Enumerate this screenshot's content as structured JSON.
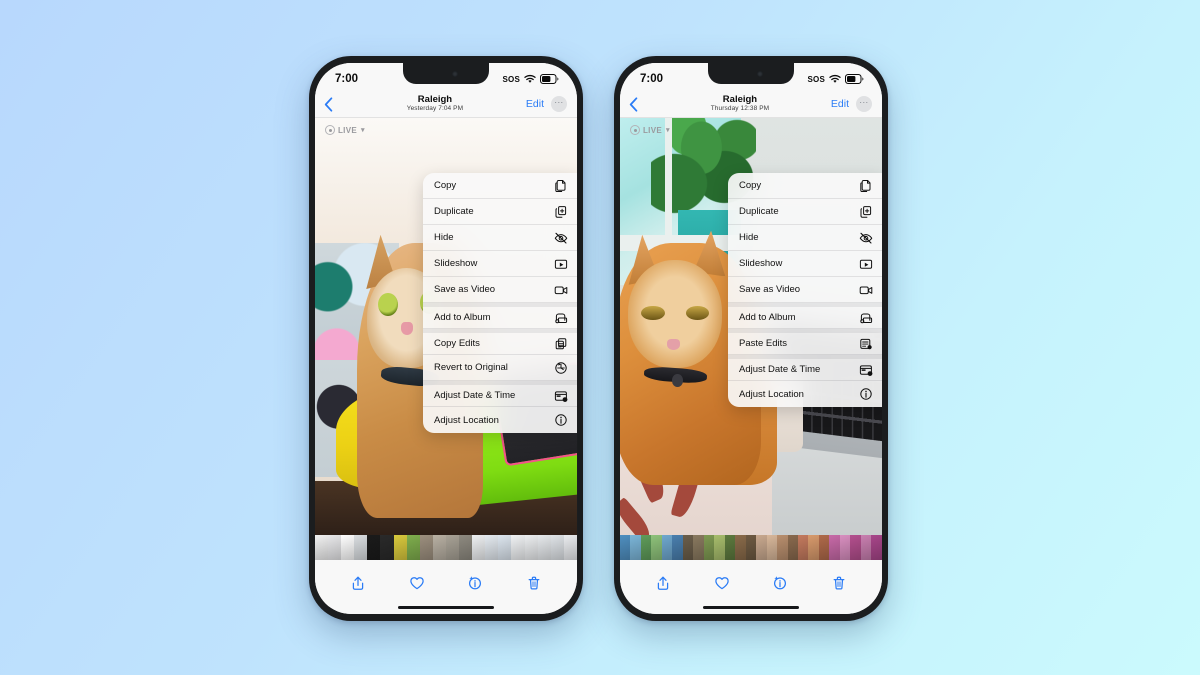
{
  "background": {
    "from": "#b8d8fd",
    "to": "#cbfafd"
  },
  "accent_color": "#2b7cf6",
  "phones": [
    {
      "id": "left",
      "status": {
        "time": "7:00",
        "sos": "SOS",
        "wifi_icon": "wifi-icon",
        "battery_icon": "battery-icon"
      },
      "nav": {
        "back_icon": "back-chevron-icon",
        "title": "Raleigh",
        "subtitle": "Yesterday  7:04 PM",
        "edit_label": "Edit",
        "more_label": "···"
      },
      "photo": {
        "live_label": "LIVE",
        "live_icon": "live-photo-icon",
        "chevron_icon": "chevron-down-icon",
        "alt": "ginger tabby cat standing on a yellow chair"
      },
      "menu": [
        {
          "label": "Copy",
          "icon": "copy-icon",
          "group_start": false
        },
        {
          "label": "Duplicate",
          "icon": "duplicate-icon",
          "group_start": false
        },
        {
          "label": "Hide",
          "icon": "eye-slash-icon",
          "group_start": false
        },
        {
          "label": "Slideshow",
          "icon": "slideshow-icon",
          "group_start": false
        },
        {
          "label": "Save as Video",
          "icon": "video-icon",
          "group_start": false
        },
        {
          "label": "Add to Album",
          "icon": "add-to-album-icon",
          "group_start": true
        },
        {
          "label": "Copy Edits",
          "icon": "copy-edits-icon",
          "group_start": true
        },
        {
          "label": "Revert to Original",
          "icon": "revert-icon",
          "group_start": false
        },
        {
          "label": "Adjust Date & Time",
          "icon": "calendar-clock-icon",
          "group_start": true
        },
        {
          "label": "Adjust Location",
          "icon": "location-info-icon",
          "group_start": false
        }
      ],
      "toolbar": [
        {
          "name": "share-button",
          "icon": "share-icon"
        },
        {
          "name": "favorite-button",
          "icon": "heart-icon"
        },
        {
          "name": "info-button",
          "icon": "info-sparkle-icon"
        },
        {
          "name": "delete-button",
          "icon": "trash-icon"
        }
      ],
      "filmstrip": [
        "#f2f2f2",
        "#e8e8ea",
        "#ffffff",
        "#d9dde0",
        "#1b1b1b",
        "#2a2a2a",
        "#d9c93d",
        "#7fae4d",
        "#9c8f7e",
        "#b8b0a3",
        "#a8a296",
        "#8e8a80",
        "#eef0f2",
        "#e4eaf0",
        "#dde6ef",
        "#f0f2f4",
        "#eceef0",
        "#e6e9ec",
        "#dfe3e7",
        "#eaecef"
      ]
    },
    {
      "id": "right",
      "status": {
        "time": "7:00",
        "sos": "SOS",
        "wifi_icon": "wifi-icon",
        "battery_icon": "battery-icon"
      },
      "nav": {
        "back_icon": "back-chevron-icon",
        "title": "Raleigh",
        "subtitle": "Thursday  12:38 PM",
        "edit_label": "Edit",
        "more_label": "···"
      },
      "photo": {
        "live_label": "LIVE",
        "live_icon": "live-photo-icon",
        "chevron_icon": "chevron-down-icon",
        "alt": "ginger tabby cat resting beside a laptop keyboard"
      },
      "menu": [
        {
          "label": "Copy",
          "icon": "copy-icon",
          "group_start": false
        },
        {
          "label": "Duplicate",
          "icon": "duplicate-icon",
          "group_start": false
        },
        {
          "label": "Hide",
          "icon": "eye-slash-icon",
          "group_start": false
        },
        {
          "label": "Slideshow",
          "icon": "slideshow-icon",
          "group_start": false
        },
        {
          "label": "Save as Video",
          "icon": "video-icon",
          "group_start": false
        },
        {
          "label": "Add to Album",
          "icon": "add-to-album-icon",
          "group_start": true
        },
        {
          "label": "Paste Edits",
          "icon": "paste-edits-icon",
          "group_start": true
        },
        {
          "label": "Adjust Date & Time",
          "icon": "calendar-clock-icon",
          "group_start": true
        },
        {
          "label": "Adjust Location",
          "icon": "location-info-icon",
          "group_start": false
        }
      ],
      "toolbar": [
        {
          "name": "share-button",
          "icon": "share-icon"
        },
        {
          "name": "favorite-button",
          "icon": "heart-icon"
        },
        {
          "name": "info-button",
          "icon": "info-sparkle-icon"
        },
        {
          "name": "delete-button",
          "icon": "trash-icon"
        }
      ],
      "filmstrip": [
        "#4f8fc0",
        "#7bb5d8",
        "#5f9c5a",
        "#8ec27a",
        "#6fa8cf",
        "#4a7fae",
        "#6b5e4a",
        "#89795f",
        "#7f9a52",
        "#a7bd6c",
        "#5d7a3e",
        "#8a6b4a",
        "#6e5a42",
        "#c9a98f",
        "#d8b79a",
        "#b98f6e",
        "#8a6a4e",
        "#c47a5e",
        "#d89a6c",
        "#b06a4a",
        "#c86aa8",
        "#d98fc0",
        "#b44f8e",
        "#c97fb0",
        "#a8468a"
      ]
    }
  ]
}
